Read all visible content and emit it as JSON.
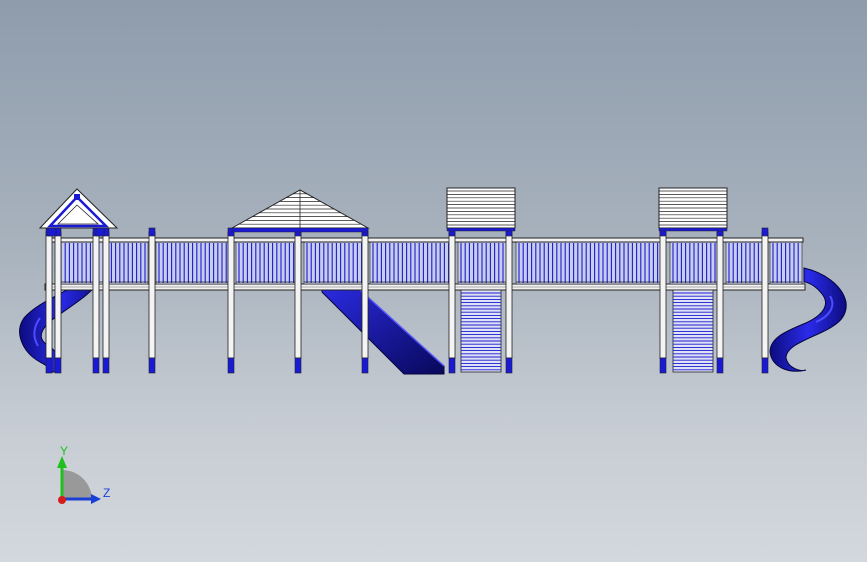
{
  "triad": {
    "y_label": "Y",
    "z_label": "Z",
    "colors": {
      "y": "#1fbf1f",
      "z": "#1a3fd6",
      "x": "#d41c1c",
      "plane": "#8f8f8f"
    }
  },
  "model": {
    "colors": {
      "blue": "#1a1ad6",
      "dark_blue": "#0a0a6e",
      "white": "#f4f4f4",
      "outline": "#222222",
      "roof_fill": "#ffffff"
    }
  }
}
